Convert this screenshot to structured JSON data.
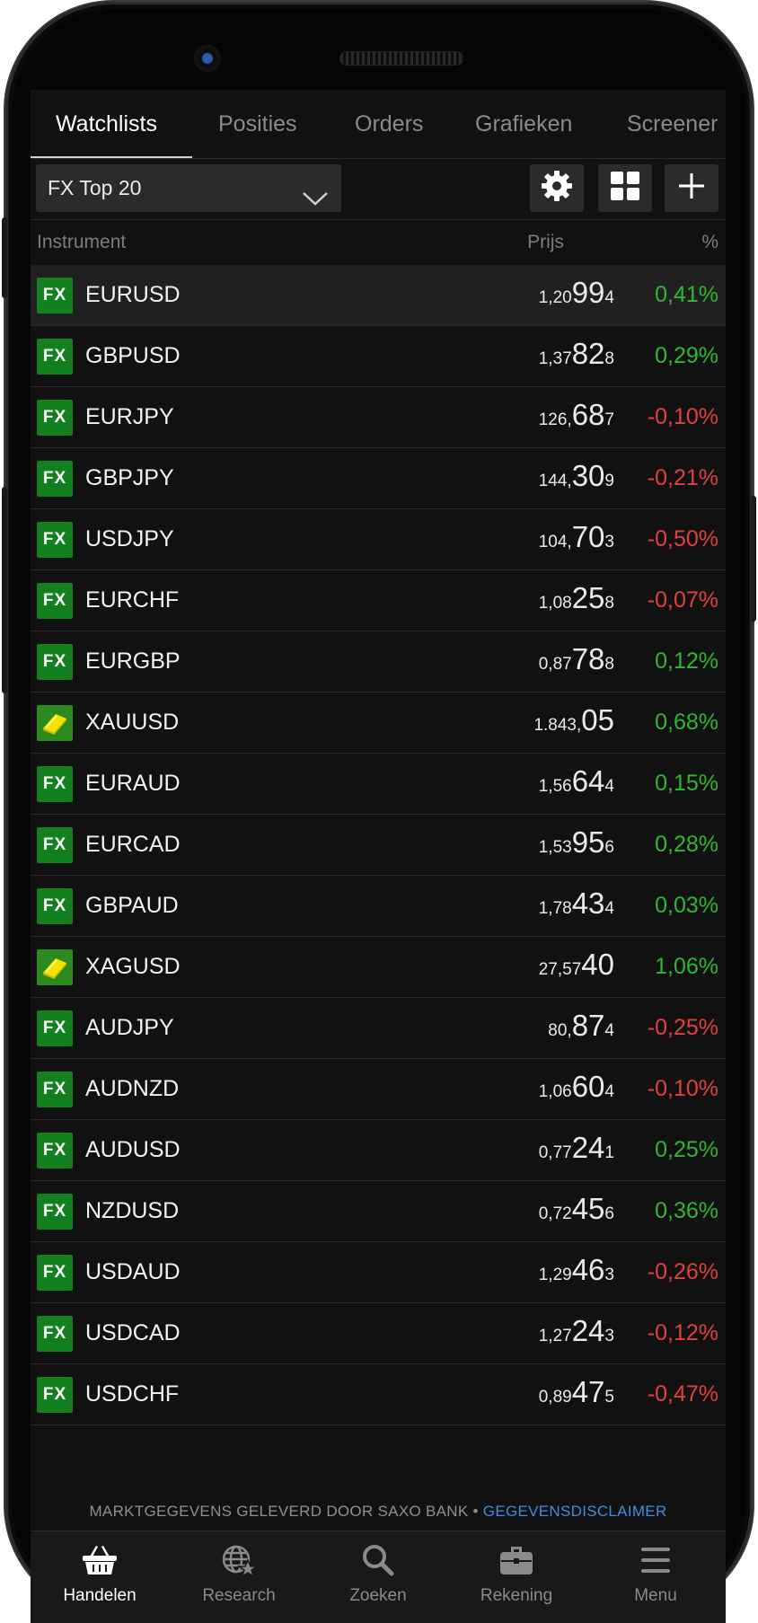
{
  "tabs": [
    "Watchlists",
    "Posities",
    "Orders",
    "Grafieken",
    "Screener"
  ],
  "watchlist": {
    "selected": "FX Top 20"
  },
  "columns": {
    "instrument": "Instrument",
    "price": "Prijs",
    "change": "%"
  },
  "rows": [
    {
      "symbol": "EURUSD",
      "type": "FX",
      "pre": "1,20",
      "big": "99",
      "small": "4",
      "pct": "0,41%",
      "dir": "up"
    },
    {
      "symbol": "GBPUSD",
      "type": "FX",
      "pre": "1,37",
      "big": "82",
      "small": "8",
      "pct": "0,29%",
      "dir": "up"
    },
    {
      "symbol": "EURJPY",
      "type": "FX",
      "pre": "126,",
      "big": "68",
      "small": "7",
      "pct": "-0,10%",
      "dir": "down"
    },
    {
      "symbol": "GBPJPY",
      "type": "FX",
      "pre": "144,",
      "big": "30",
      "small": "9",
      "pct": "-0,21%",
      "dir": "down"
    },
    {
      "symbol": "USDJPY",
      "type": "FX",
      "pre": "104,",
      "big": "70",
      "small": "3",
      "pct": "-0,50%",
      "dir": "down"
    },
    {
      "symbol": "EURCHF",
      "type": "FX",
      "pre": "1,08",
      "big": "25",
      "small": "8",
      "pct": "-0,07%",
      "dir": "down"
    },
    {
      "symbol": "EURGBP",
      "type": "FX",
      "pre": "0,87",
      "big": "78",
      "small": "8",
      "pct": "0,12%",
      "dir": "up"
    },
    {
      "symbol": "XAUUSD",
      "type": "metal",
      "pre": "1.843,",
      "big": "05",
      "small": "",
      "pct": "0,68%",
      "dir": "up"
    },
    {
      "symbol": "EURAUD",
      "type": "FX",
      "pre": "1,56",
      "big": "64",
      "small": "4",
      "pct": "0,15%",
      "dir": "up"
    },
    {
      "symbol": "EURCAD",
      "type": "FX",
      "pre": "1,53",
      "big": "95",
      "small": "6",
      "pct": "0,28%",
      "dir": "up"
    },
    {
      "symbol": "GBPAUD",
      "type": "FX",
      "pre": "1,78",
      "big": "43",
      "small": "4",
      "pct": "0,03%",
      "dir": "up"
    },
    {
      "symbol": "XAGUSD",
      "type": "metal",
      "pre": "27,57",
      "big": "40",
      "small": "",
      "pct": "1,06%",
      "dir": "up"
    },
    {
      "symbol": "AUDJPY",
      "type": "FX",
      "pre": "80,",
      "big": "87",
      "small": "4",
      "pct": "-0,25%",
      "dir": "down"
    },
    {
      "symbol": "AUDNZD",
      "type": "FX",
      "pre": "1,06",
      "big": "60",
      "small": "4",
      "pct": "-0,10%",
      "dir": "down"
    },
    {
      "symbol": "AUDUSD",
      "type": "FX",
      "pre": "0,77",
      "big": "24",
      "small": "1",
      "pct": "0,25%",
      "dir": "up"
    },
    {
      "symbol": "NZDUSD",
      "type": "FX",
      "pre": "0,72",
      "big": "45",
      "small": "6",
      "pct": "0,36%",
      "dir": "up"
    },
    {
      "symbol": "USDAUD",
      "type": "FX",
      "pre": "1,29",
      "big": "46",
      "small": "3",
      "pct": "-0,26%",
      "dir": "down"
    },
    {
      "symbol": "USDCAD",
      "type": "FX",
      "pre": "1,27",
      "big": "24",
      "small": "3",
      "pct": "-0,12%",
      "dir": "down"
    },
    {
      "symbol": "USDCHF",
      "type": "FX",
      "pre": "0,89",
      "big": "47",
      "small": "5",
      "pct": "-0,47%",
      "dir": "down"
    }
  ],
  "badge_text": "FX",
  "disclaimer": {
    "text": "MARKTGEGEVENS GELEVERD DOOR SAXO BANK • ",
    "link": "GEGEVENSDISCLAIMER"
  },
  "bottom_nav": [
    {
      "label": "Handelen",
      "icon": "basket-icon",
      "active": true
    },
    {
      "label": "Research",
      "icon": "globe-star-icon",
      "active": false
    },
    {
      "label": "Zoeken",
      "icon": "search-icon",
      "active": false
    },
    {
      "label": "Rekening",
      "icon": "briefcase-icon",
      "active": false
    },
    {
      "label": "Menu",
      "icon": "hamburger-icon",
      "active": false
    }
  ],
  "colors": {
    "up": "#2eb82e",
    "down": "#e0413a",
    "fx_badge": "#13801f",
    "link": "#3d8ee0"
  }
}
